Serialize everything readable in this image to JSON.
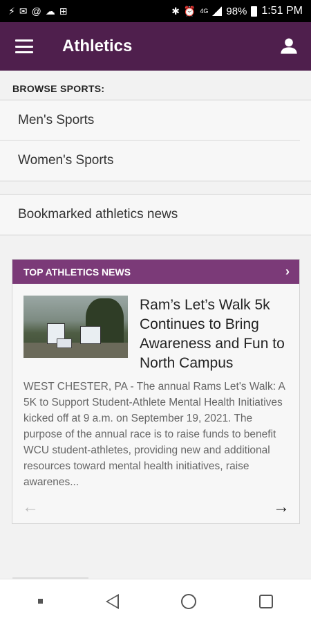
{
  "status_bar": {
    "left_icons": [
      "wifi-x-icon",
      "mail-icon",
      "at-icon",
      "cloud-icon",
      "plus-box-icon"
    ],
    "bluetooth": "✱",
    "alarm": "⏰",
    "network": "4G",
    "battery_pct": "98%",
    "time": "1:51 PM"
  },
  "app_bar": {
    "title": "Athletics",
    "menu_icon": "hamburger-menu-icon",
    "account_icon": "account-icon",
    "color": "#4f1f4d"
  },
  "browse": {
    "label": "BROWSE SPORTS:",
    "items": [
      "Men's Sports",
      "Women's Sports"
    ]
  },
  "bookmarked": {
    "label": "Bookmarked athletics news"
  },
  "news": {
    "header": "TOP ATHLETICS NEWS",
    "header_color": "#7b3a78",
    "title": "Ram’s Let’s Walk 5k Continues to Bring Awareness and Fun to North Campus",
    "body": "WEST CHESTER, PA - The annual Rams Let's Walk: A 5K to Support Student-Athlete Mental Health Initiatives kicked off at 9 a.m. on September 19, 2021. The purpose of the annual race is to raise funds to benefit WCU student-athletes, providing new and additional resources toward mental health initiatives, raise awarenes...",
    "prev_arrow": "←",
    "next_arrow": "→",
    "chevron": "›"
  },
  "nav_bar": {
    "buttons": [
      "overview",
      "back",
      "home",
      "recent-apps"
    ]
  }
}
